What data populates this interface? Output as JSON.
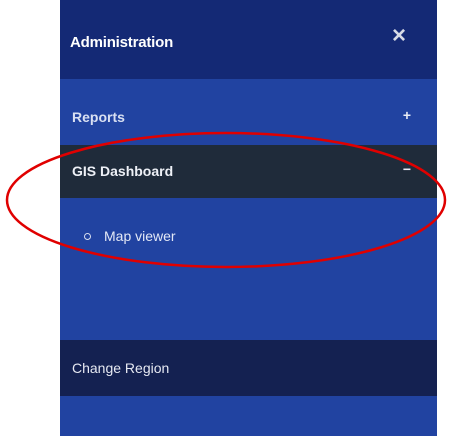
{
  "header": {
    "title": "Administration",
    "close_glyph": "×"
  },
  "menu": {
    "reports": {
      "label": "Reports",
      "toggle": "+"
    },
    "gis": {
      "label": "GIS Dashboard",
      "toggle": "−"
    },
    "gis_children": [
      {
        "label": "Map viewer",
        "icon": "circle-bullet-icon"
      }
    ],
    "change_region": {
      "label": "Change Region"
    }
  },
  "colors": {
    "header_bg": "#142975",
    "menu_bg": "#2143a1",
    "active_row_bg": "#1f2b3a",
    "footer_item_bg": "#142151",
    "annotation": "#e00000"
  }
}
